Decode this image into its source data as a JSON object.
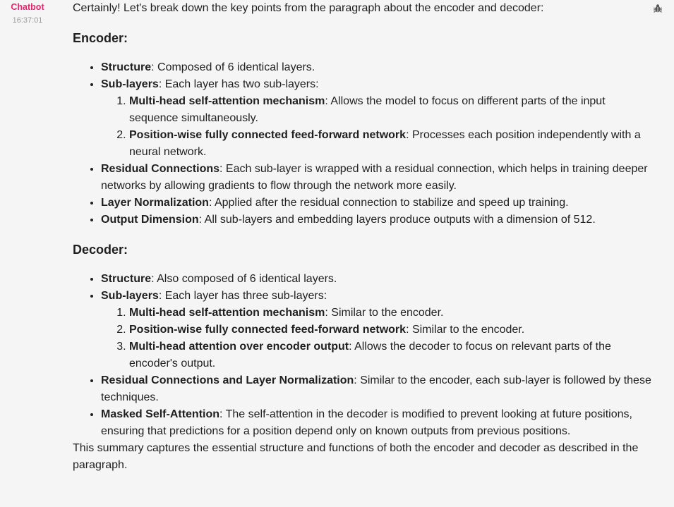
{
  "sender": {
    "name": "Chatbot",
    "time": "16:37:01"
  },
  "message": {
    "intro": "Certainly! Let's break down the key points from the paragraph about the encoder and decoder:",
    "encoder": {
      "heading": "Encoder:",
      "structure": {
        "term": "Structure",
        "text": ": Composed of 6 identical layers."
      },
      "sublayers": {
        "term": "Sub-layers",
        "text": ": Each layer has two sub-layers:",
        "items": [
          {
            "term": "Multi-head self-attention mechanism",
            "text": ": Allows the model to focus on different parts of the input sequence simultaneously."
          },
          {
            "term": "Position-wise fully connected feed-forward network",
            "text": ": Processes each position independently with a neural network."
          }
        ]
      },
      "residual": {
        "term": "Residual Connections",
        "text": ": Each sub-layer is wrapped with a residual connection, which helps in training deeper networks by allowing gradients to flow through the network more easily."
      },
      "layernorm": {
        "term": "Layer Normalization",
        "text": ": Applied after the residual connection to stabilize and speed up training."
      },
      "output_dim": {
        "term": "Output Dimension",
        "text": ": All sub-layers and embedding layers produce outputs with a dimension of 512."
      }
    },
    "decoder": {
      "heading": "Decoder:",
      "structure": {
        "term": "Structure",
        "text": ": Also composed of 6 identical layers."
      },
      "sublayers": {
        "term": "Sub-layers",
        "text": ": Each layer has three sub-layers:",
        "items": [
          {
            "term": "Multi-head self-attention mechanism",
            "text": ": Similar to the encoder."
          },
          {
            "term": "Position-wise fully connected feed-forward network",
            "text": ": Similar to the encoder."
          },
          {
            "term": "Multi-head attention over encoder output",
            "text": ": Allows the decoder to focus on relevant parts of the encoder's output."
          }
        ]
      },
      "residual_norm": {
        "term": "Residual Connections and Layer Normalization",
        "text": ": Similar to the encoder, each sub-layer is followed by these techniques."
      },
      "masked": {
        "term": "Masked Self-Attention",
        "text": ": The self-attention in the decoder is modified to prevent looking at future positions, ensuring that predictions for a position depend only on known outputs from previous positions."
      }
    },
    "summary": "This summary captures the essential structure and functions of both the encoder and decoder as described in the paragraph."
  },
  "icons": {
    "settings": "bug-icon"
  },
  "colors": {
    "sender_name": "#e6266e",
    "timestamp": "#9a9a9a",
    "background": "#f5f5f5",
    "text": "#1f1f1f"
  }
}
